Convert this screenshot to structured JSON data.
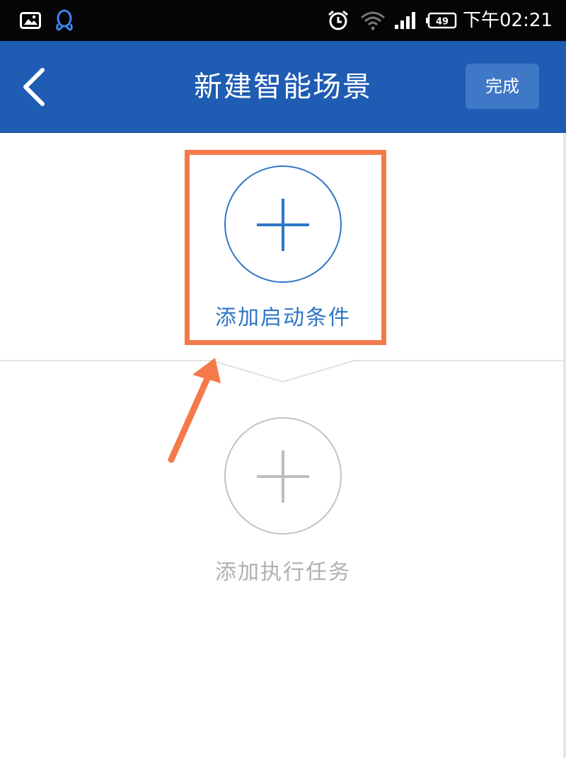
{
  "status_bar": {
    "time": "下午02:21",
    "battery_level": "49",
    "icons": [
      "image-icon",
      "qq-icon",
      "alarm-icon",
      "wifi-icon",
      "signal-icon",
      "battery-icon"
    ]
  },
  "header": {
    "title": "新建智能场景",
    "done_label": "完成",
    "back_icon": "chevron-left-icon",
    "background_color": "#1f5cb3"
  },
  "main": {
    "condition": {
      "label": "添加启动条件",
      "icon": "plus-icon",
      "color": "#2e76c6"
    },
    "task": {
      "label": "添加执行任务",
      "icon": "plus-icon",
      "color": "#b0b0b0"
    }
  },
  "annotation": {
    "highlight_color": "#f47a4a"
  }
}
